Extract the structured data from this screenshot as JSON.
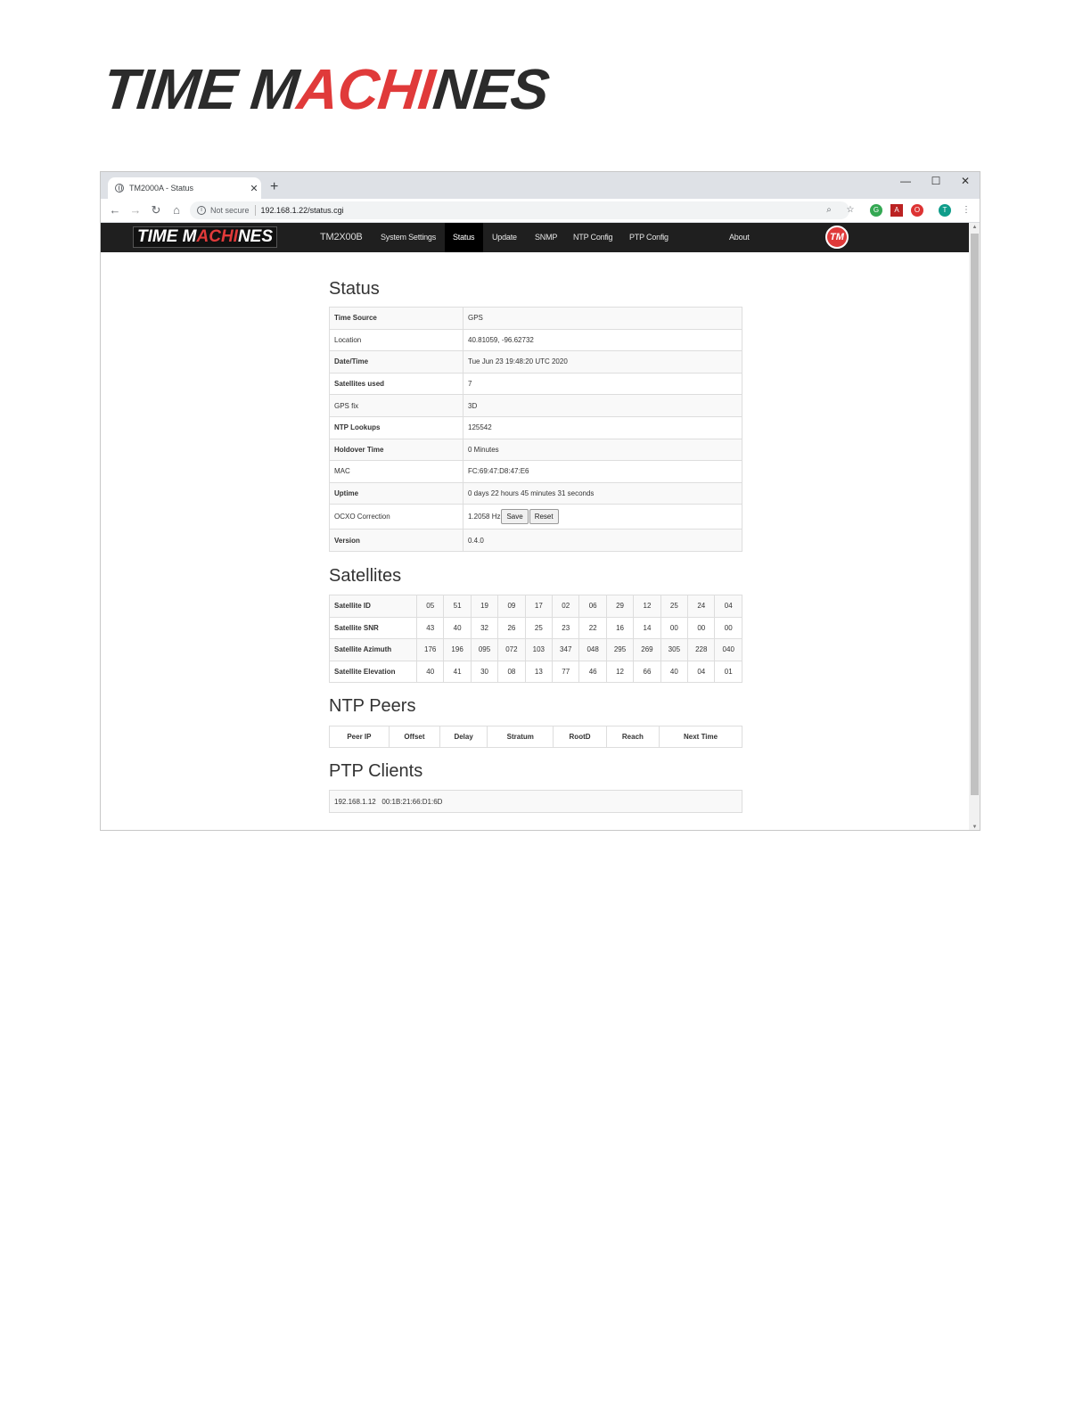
{
  "doc_logo": {
    "part1": "TIME M",
    "part2": "ACHI",
    "part3": "NES"
  },
  "browser": {
    "tab_title": "TM2000A - Status",
    "tab_close": "✕",
    "new_tab": "+",
    "win_min": "—",
    "win_max": "☐",
    "win_close": "✕",
    "security": "Not secure",
    "url": "192.168.1.22/status.cgi",
    "icons": [
      "back-arrow-icon",
      "forward-arrow-icon",
      "reload-icon",
      "home-icon",
      "zoom-icon",
      "star-icon",
      "extension-icon",
      "pdf-icon",
      "shield-icon",
      "profile-icon",
      "menu-icon"
    ],
    "profile_letter": "T"
  },
  "site_nav": {
    "logo": {
      "part1": "TIME M",
      "part2": "ACHI",
      "part3": "NES"
    },
    "brand": "TM2X00B",
    "items": [
      "System Settings",
      "Status",
      "Update",
      "SNMP",
      "NTP Config",
      "PTP Config",
      "About"
    ],
    "active": "Status",
    "badge": "TM"
  },
  "status": {
    "title": "Status",
    "rows": [
      {
        "label": "Time Source",
        "value": "GPS"
      },
      {
        "label": "Location",
        "value": "40.81059, -96.62732"
      },
      {
        "label": "Date/Time",
        "value": "Tue Jun 23 19:48:20 UTC 2020"
      },
      {
        "label": "Satellites used",
        "value": "7"
      },
      {
        "label": "GPS fix",
        "value": "3D"
      },
      {
        "label": "NTP Lookups",
        "value": "125542"
      },
      {
        "label": "Holdover Time",
        "value": "0 Minutes"
      },
      {
        "label": "MAC",
        "value": "FC:69:47:D8:47:E6"
      },
      {
        "label": "Uptime",
        "value": "0 days 22 hours 45 minutes 31 seconds"
      }
    ],
    "ocxo": {
      "label": "OCXO Correction",
      "value": "1.2058 Hz",
      "save": "Save",
      "reset": "Reset"
    },
    "version": {
      "label": "Version",
      "value": "0.4.0"
    }
  },
  "satellites": {
    "title": "Satellites",
    "rows": [
      {
        "label": "Satellite ID",
        "values": [
          "05",
          "51",
          "19",
          "09",
          "17",
          "02",
          "06",
          "29",
          "12",
          "25",
          "24",
          "04"
        ]
      },
      {
        "label": "Satellite SNR",
        "values": [
          "43",
          "40",
          "32",
          "26",
          "25",
          "23",
          "22",
          "16",
          "14",
          "00",
          "00",
          "00"
        ]
      },
      {
        "label": "Satellite Azimuth",
        "values": [
          "176",
          "196",
          "095",
          "072",
          "103",
          "347",
          "048",
          "295",
          "269",
          "305",
          "228",
          "040"
        ]
      },
      {
        "label": "Satellite Elevation",
        "values": [
          "40",
          "41",
          "30",
          "08",
          "13",
          "77",
          "46",
          "12",
          "66",
          "40",
          "04",
          "01"
        ]
      }
    ]
  },
  "ntp_peers": {
    "title": "NTP Peers",
    "headers": [
      "Peer IP",
      "Offset",
      "Delay",
      "Stratum",
      "RootD",
      "Reach",
      "Next Time"
    ]
  },
  "ptp_clients": {
    "title": "PTP Clients",
    "rows": [
      "192.168.1.12   00:1B:21:66:D1:6D"
    ]
  }
}
